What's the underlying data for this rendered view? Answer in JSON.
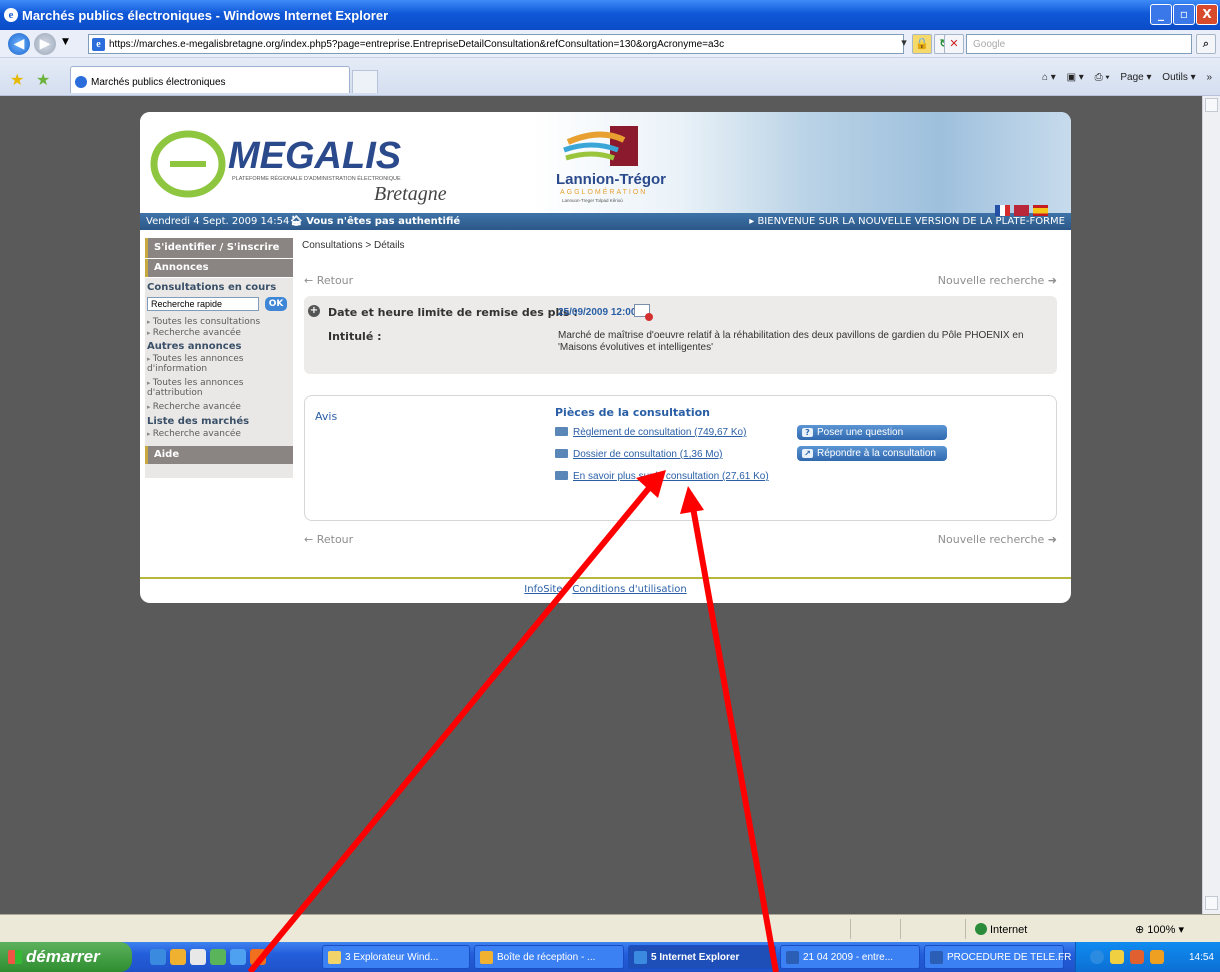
{
  "window": {
    "title": "Marchés publics électroniques - Windows Internet Explorer",
    "min": "_",
    "max": "▫",
    "close": "X"
  },
  "address": {
    "url": "https://marches.e-megalisbretagne.org/index.php5?page=entreprise.EntrepriseDetailConsultation&refConsultation=130&orgAcronyme=a3c",
    "search_placeholder": "Google"
  },
  "tab": {
    "label": "Marchés publics électroniques"
  },
  "commandbar": {
    "page": "Page ▾",
    "tools": "Outils ▾"
  },
  "banner": {
    "megalis_name": "MEGALIS",
    "megalis_sub": "PLATEFORME RÉGIONALE D'ADMINISTRATION ÉLECTRONIQUE",
    "megalis_region": "Bretagne",
    "lannion_name": "Lannion-Trégor",
    "lannion_sub": "AGGLOMÉRATION",
    "lannion_tag": "Lannuon-Treger Tolpad Kêrioù"
  },
  "infobar": {
    "date": "Vendredi 4 Sept. 2009 14:54",
    "auth": "Vous n'êtes pas authentifié",
    "welcome": "BIENVENUE SUR LA NOUVELLE VERSION DE LA PLATE-FORME"
  },
  "sidebar": {
    "identify": "S'identifier / S'inscrire",
    "annonces": "Annonces",
    "consultations_title": "Consultations en cours",
    "search_value": "Recherche rapide",
    "ok": "OK",
    "links1": [
      "Toutes les consultations",
      "Recherche avancée"
    ],
    "autres_title": "Autres annonces",
    "links2": [
      "Toutes les annonces d'information",
      "Toutes les annonces d'attribution",
      "Recherche avancée"
    ],
    "marches_title": "Liste des marchés",
    "links3": [
      "Recherche avancée"
    ],
    "aide": "Aide"
  },
  "main": {
    "breadcrumb": "Consultations > Détails",
    "retour": "← Retour",
    "nouvelle": "Nouvelle recherche ➜",
    "deadline_label": "Date et heure limite de remise des plis :",
    "deadline_value": "25/09/2009 12:00",
    "intitule_label": "Intitulé :",
    "intitule_value": "Marché de maîtrise d'oeuvre relatif à la réhabilitation des deux pavillons de gardien du Pôle PHOENIX en 'Maisons évolutives et intelligentes'",
    "avis": "Avis",
    "pieces_title": "Pièces de la consultation",
    "doc1": "Règlement de consultation (749,67 Ko)",
    "doc2": "Dossier de consultation (1,36 Mo)",
    "doc3": "En savoir plus sur la consultation (27,61 Ko)",
    "btn_question": "Poser une question",
    "btn_repondre": "Répondre à la consultation"
  },
  "footer": {
    "infosite": "InfoSite",
    "sep": "-",
    "conditions": "Conditions d'utilisation"
  },
  "status": {
    "zone": "Internet",
    "zoom": "100%"
  },
  "taskbar": {
    "start": "démarrer",
    "tasks": [
      "3 Explorateur Wind...",
      "Boîte de réception - ...",
      "5 Internet Explorer",
      "21 04 2009 - entre...",
      "PROCEDURE DE TELE..."
    ],
    "lang": "FR",
    "clock": "14:54"
  },
  "colors": {
    "accent": "#2a5fa6",
    "annotation": "#ff0000"
  }
}
